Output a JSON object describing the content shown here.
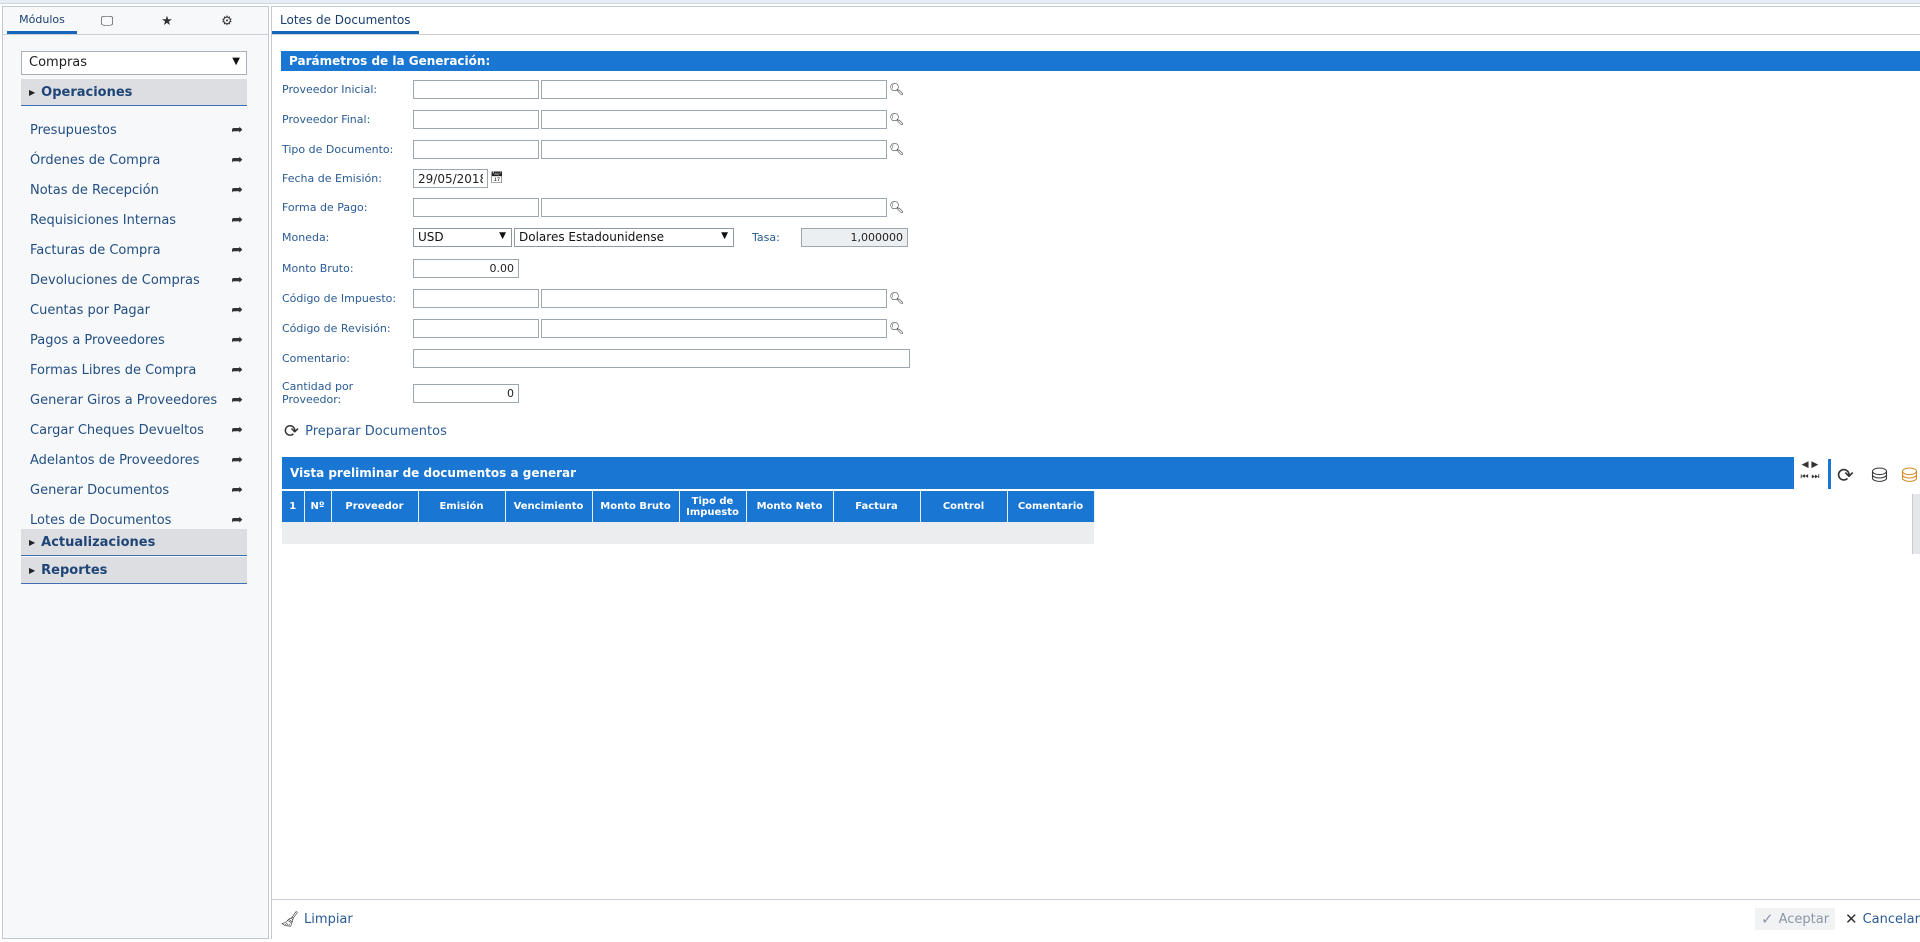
{
  "sidebar": {
    "tabs": [
      {
        "label": "Módulos",
        "icon": ""
      },
      {
        "label": "",
        "icon": "🖵"
      },
      {
        "label": "",
        "icon": "★"
      },
      {
        "label": "",
        "icon": "⚙"
      }
    ],
    "module_select": "Compras",
    "sections": {
      "operaciones": "Operaciones",
      "actualizaciones": "Actualizaciones",
      "reportes": "Reportes"
    },
    "items": [
      "Presupuestos",
      "Órdenes de Compra",
      "Notas de Recepción",
      "Requisiciones Internas",
      "Facturas de Compra",
      "Devoluciones de Compras",
      "Cuentas por Pagar",
      "Pagos a Proveedores",
      "Formas Libres de Compra",
      "Generar Giros a Proveedores",
      "Cargar Cheques Devueltos",
      "Adelantos de Proveedores",
      "Generar Documentos",
      "Lotes de Documentos"
    ]
  },
  "main": {
    "tab": "Lotes de Documentos",
    "params_title": "Parámetros de la Generación:",
    "labels": {
      "proveedor_inicial": "Proveedor Inicial:",
      "proveedor_final": "Proveedor Final:",
      "tipo_documento": "Tipo de Documento:",
      "fecha_emision": "Fecha de Emisión:",
      "forma_pago": "Forma de Pago:",
      "moneda": "Moneda:",
      "tasa": "Tasa:",
      "monto_bruto": "Monto Bruto:",
      "codigo_impuesto": "Código de Impuesto:",
      "codigo_revision": "Código de Revisión:",
      "comentario": "Comentario:",
      "cantidad_por": "Cantidad por",
      "proveedor": "Proveedor:"
    },
    "values": {
      "fecha_emision": "29/05/2018",
      "moneda_code": "USD",
      "moneda_name": "Dolares Estadounidense",
      "tasa": "1,000000",
      "monto_bruto": "0.00",
      "cantidad": "0"
    },
    "prepare_label": "Preparar Documentos",
    "preview_title": "Vista preliminar de documentos a generar",
    "grid_headers": [
      "1",
      "Nº",
      "Proveedor",
      "Emisión",
      "Vencimiento",
      "Monto Bruto",
      "Tipo de Impuesto",
      "Monto Neto",
      "Factura",
      "Control",
      "Comentario"
    ],
    "footer": {
      "limpiar": "Limpiar",
      "aceptar": "Aceptar",
      "cancelar": "Cancelar"
    }
  }
}
